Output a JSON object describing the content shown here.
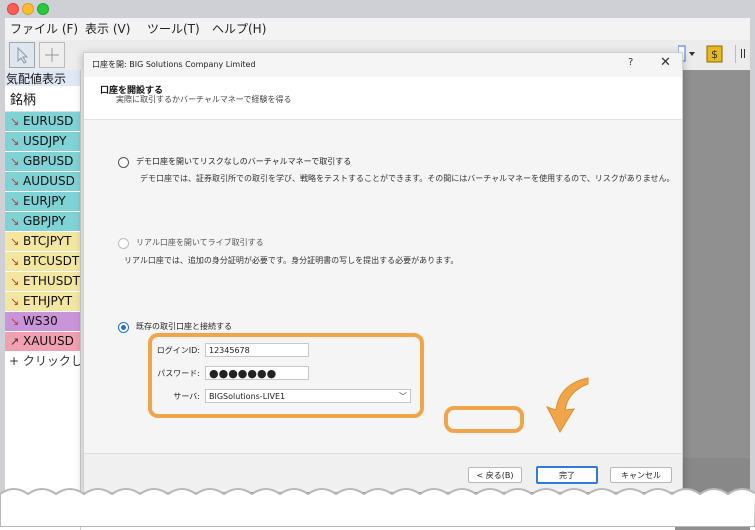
{
  "menu": [
    "ファイル (F)",
    "表示 (V)",
    "ツール(T)",
    "ヘルプ(H)"
  ],
  "watch": {
    "title": "気配値表示",
    "header": "銘柄",
    "symbols": [
      {
        "name": "EURUSD",
        "color": "#7fd3d6",
        "dir": "down"
      },
      {
        "name": "USDJPY",
        "color": "#7fd3d6",
        "dir": "down"
      },
      {
        "name": "GBPUSD",
        "color": "#7fd3d6",
        "dir": "down"
      },
      {
        "name": "AUDUSD",
        "color": "#7fd3d6",
        "dir": "down"
      },
      {
        "name": "EURJPY",
        "color": "#7fd3d6",
        "dir": "down"
      },
      {
        "name": "GBPJPY",
        "color": "#7fd3d6",
        "dir": "down"
      },
      {
        "name": "BTCJPYT",
        "color": "#f2e6a0",
        "dir": "down"
      },
      {
        "name": "BTCUSDT",
        "color": "#f2e6a0",
        "dir": "down"
      },
      {
        "name": "ETHUSDT",
        "color": "#f2e6a0",
        "dir": "down"
      },
      {
        "name": "ETHJPYT",
        "color": "#f2e6a0",
        "dir": "down"
      },
      {
        "name": "WS30",
        "color": "#c995d8",
        "dir": "down"
      },
      {
        "name": "XAUUSD",
        "color": "#f0a0b0",
        "dir": "up"
      }
    ],
    "add": "クリックして追加"
  },
  "dialog": {
    "title": "口座を開: BIG Solutions Company Limited",
    "help": "?",
    "close": "✕",
    "heading": "口座を開設する",
    "subheading": "実際に取引するかバーチャルマネーで経験を得る",
    "options": [
      {
        "title": "デモ口座を開いてリスクなしのバーチャルマネーで取引する",
        "desc": "デモ口座では、証券取引所での取引を学び、戦略をテストすることができます。その間にはバーチャルマネーを使用するので、リスクがありません。"
      },
      {
        "title": "リアル口座を開いてライブ取引する",
        "desc": "リアル口座では、追加の身分証明が必要です。身分証明書の写しを提出する必要があります。"
      },
      {
        "title": "既存の取引口座と接続する",
        "desc": ""
      }
    ],
    "login": {
      "login_label": "ログインID:",
      "login_value": "12345678",
      "password_label": "パスワード:",
      "password_value": "●●●●●●●",
      "server_label": "サーバ:",
      "server_value": "BIGSolutions-LIVE1"
    },
    "buttons": {
      "back": "< 戻る(B)",
      "finish": "完了",
      "cancel": "キャンセル"
    }
  },
  "colors": {
    "highlight": "#f0a54a",
    "primary": "#2f7bd7"
  }
}
